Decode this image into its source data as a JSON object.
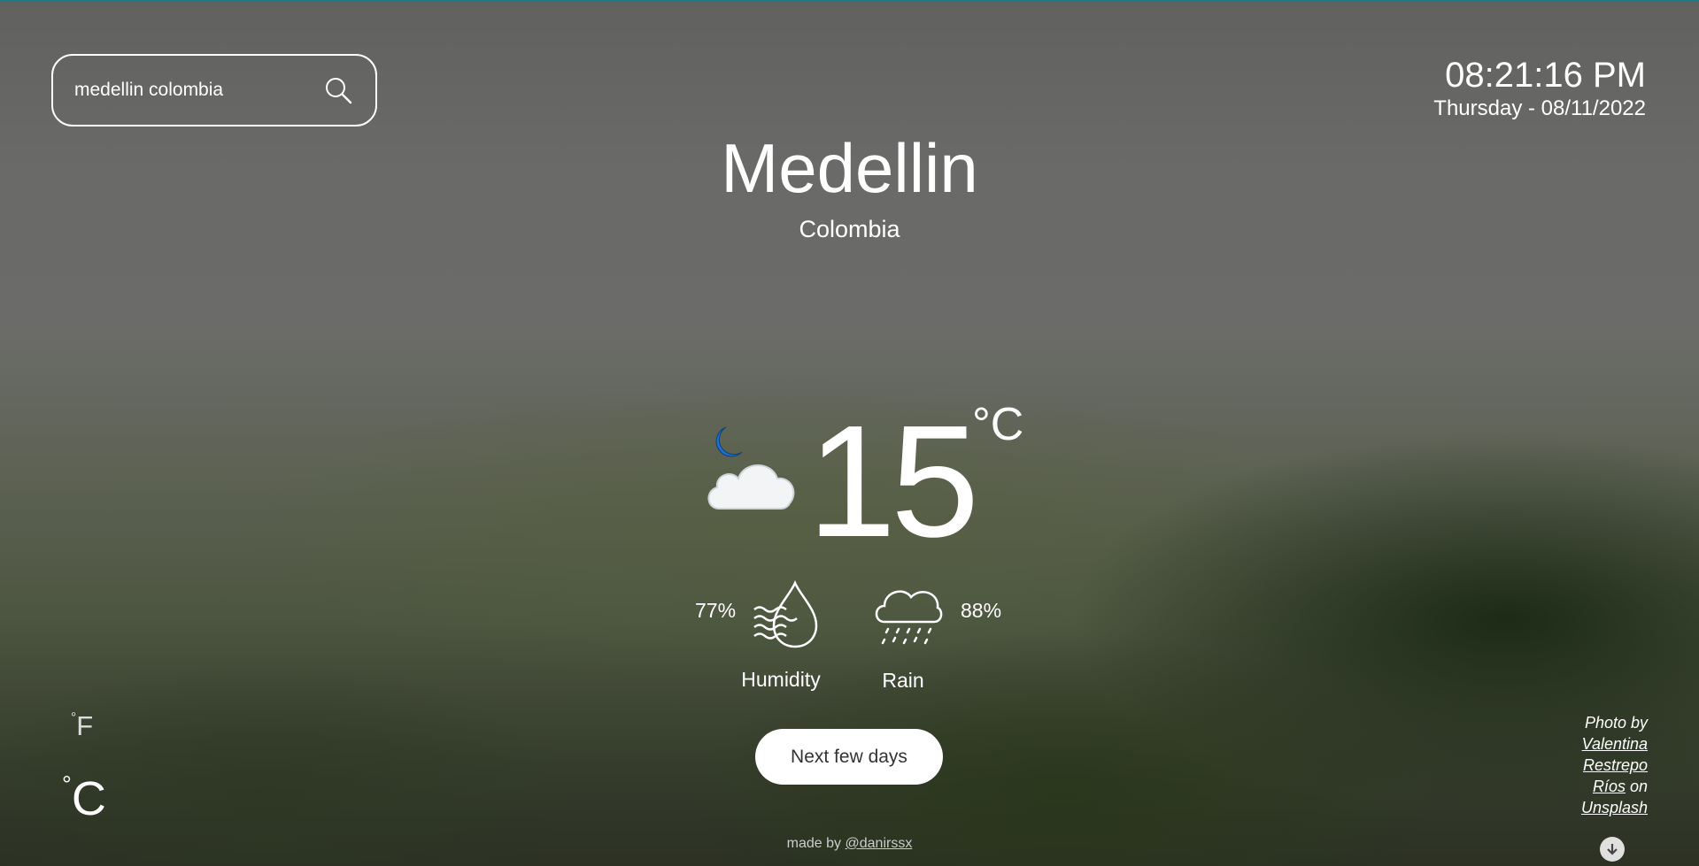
{
  "search": {
    "value": "medellin colombia",
    "icon": "search-icon"
  },
  "clock": {
    "time": "08:21:16 PM",
    "date": "Thursday - 08/11/2022"
  },
  "location": {
    "city": "Medellin",
    "country": "Colombia"
  },
  "current": {
    "icon": "cloudy-night-icon",
    "temperature": "15",
    "unit": "°C"
  },
  "stats": {
    "humidity": {
      "value": "77%",
      "label": "Humidity",
      "icon": "humidity-icon"
    },
    "rain": {
      "value": "88%",
      "label": "Rain",
      "icon": "rain-cloud-icon"
    }
  },
  "next_button": "Next few days",
  "unit_toggle": {
    "fahrenheit": "F",
    "celsius": "C",
    "degree": "°"
  },
  "credit": {
    "prefix": "Photo by",
    "author1": "Valentina",
    "author2": "Restrepo",
    "author3": "Ríos",
    "on": "on",
    "site": "Unsplash"
  },
  "footer": {
    "made_by": "made by",
    "handle": "@danirssx"
  },
  "colors": {
    "accent_line": "#1b7a8a",
    "moon": "#1e6fd0",
    "text": "#ffffff"
  }
}
